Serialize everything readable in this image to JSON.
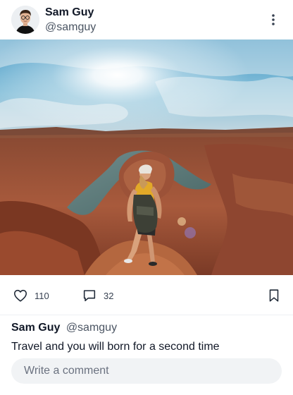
{
  "post": {
    "author": {
      "name": "Sam Guy",
      "handle": "@samguy"
    },
    "image": {
      "description": "canyon-hiker-photo"
    },
    "actions": {
      "likes": "110",
      "comments": "32"
    },
    "caption": {
      "name": "Sam Guy",
      "handle": "@samguy",
      "text": "Travel and you will born for a second time"
    },
    "comment_input": {
      "placeholder": "Write a comment",
      "value": ""
    }
  },
  "icons": {
    "more": "more-vertical-icon",
    "like": "heart-icon",
    "comment": "chat-bubble-icon",
    "bookmark": "bookmark-icon"
  },
  "colors": {
    "text_primary": "#111827",
    "text_secondary": "#4b5563",
    "input_bg": "#f1f3f5",
    "divider": "#eef0f3"
  }
}
